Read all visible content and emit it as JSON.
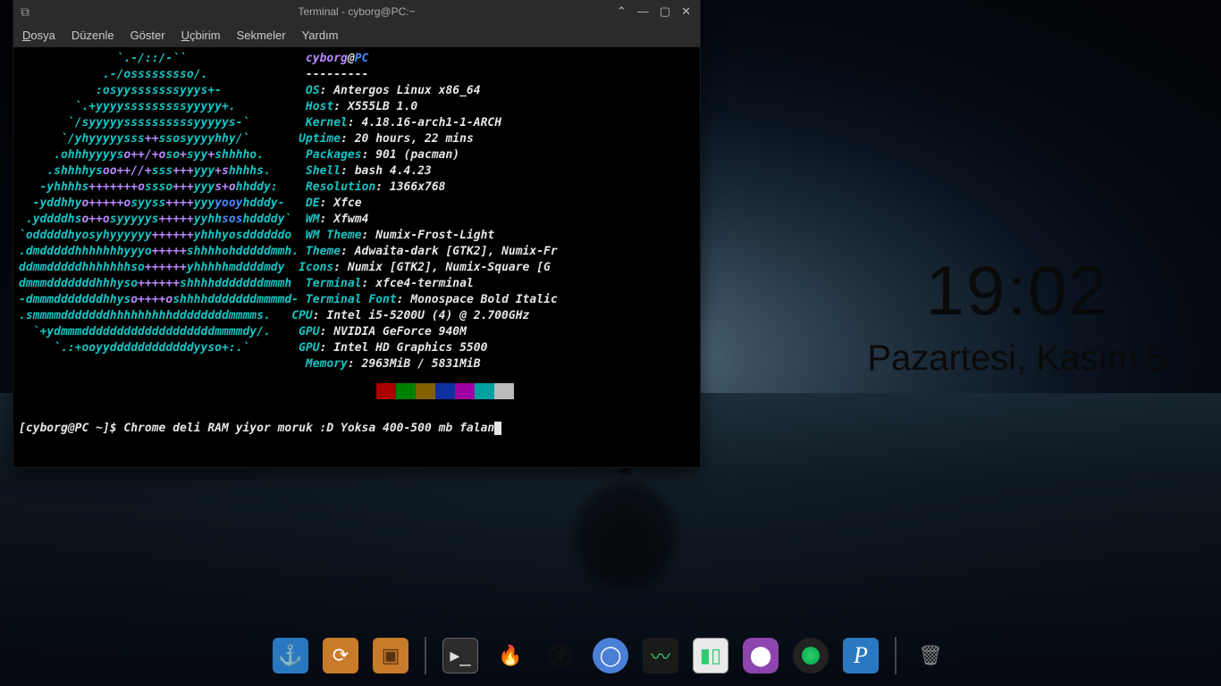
{
  "window": {
    "title": "Terminal - cyborg@PC:~"
  },
  "menu": {
    "file": "Dosya",
    "edit": "Düzenle",
    "view": "Göster",
    "terminal": "Uçbirim",
    "tabs": "Sekmeler",
    "help": "Yardım"
  },
  "neofetch": {
    "user": "cyborg",
    "at": "@",
    "host": "PC",
    "dashes": "---------",
    "labels": {
      "os": "OS",
      "host": "Host",
      "kernel": "Kernel",
      "uptime": "Uptime",
      "packages": "Packages",
      "shell": "Shell",
      "resolution": "Resolution",
      "de": "DE",
      "wm": "WM",
      "wmtheme": "WM Theme",
      "theme": "Theme",
      "icons": "Icons",
      "terminal": "Terminal",
      "termfont": "Terminal Font",
      "cpu": "CPU",
      "gpu1": "GPU",
      "gpu2": "GPU",
      "memory": "Memory"
    },
    "values": {
      "os": "Antergos Linux x86_64",
      "host": "X555LB 1.0",
      "kernel": "4.18.16-arch1-1-ARCH",
      "uptime": "20 hours, 22 mins",
      "packages": "901 (pacman)",
      "shell": "bash 4.4.23",
      "resolution": "1366x768",
      "de": "Xfce",
      "wm": "Xfwm4",
      "wmtheme": "Numix-Frost-Light",
      "theme": "Adwaita-dark [GTK2], Numix-Fr",
      "icons": "Numix [GTK2], Numix-Square [G",
      "terminal": "xfce4-terminal",
      "termfont": "Monospace Bold Italic",
      "cpu": "Intel i5-5200U (4) @ 2.700GHz",
      "gpu1": "NVIDIA GeForce 940M",
      "gpu2": "Intel HD Graphics 5500",
      "memory": "2963MiB / 5831MiB"
    },
    "swatches": [
      "#aa0000",
      "#008000",
      "#806000",
      "#1030a0",
      "#a000a0",
      "#00a0a0",
      "#bbbbbb"
    ]
  },
  "prompt": {
    "ps1": "[cyborg@PC ~]$ ",
    "command": "Chrome deli RAM yiyor moruk :D Yoksa 400-500 mb falan"
  },
  "clock": {
    "time": "19:02",
    "date": "Pazartesi, Kasım 5"
  },
  "dock": {
    "anchor": "anchor-icon",
    "pkg_update": "package-update-icon",
    "packages": "packages-icon",
    "terminal": "terminal-icon",
    "torch": "torch-icon",
    "network": "network-config-icon",
    "chromium": "chromium-icon",
    "sysmon": "system-monitor-icon",
    "battery": "battery-icon",
    "toggle": "toggle-icon",
    "camera": "camera-icon",
    "p_app": "p-app-icon",
    "trash": "trash-icon"
  }
}
